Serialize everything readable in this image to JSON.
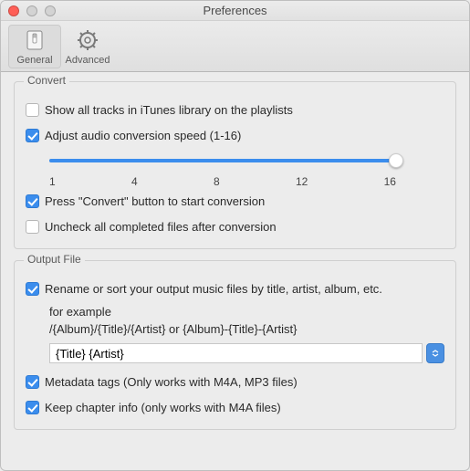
{
  "window": {
    "title": "Preferences"
  },
  "toolbar": {
    "general": "General",
    "advanced": "Advanced"
  },
  "convert": {
    "label": "Convert",
    "show_all_tracks": "Show all tracks in iTunes library on the playlists",
    "adjust_speed": "Adjust audio conversion speed (1-16)",
    "ticks": {
      "t1": "1",
      "t2": "4",
      "t3": "8",
      "t4": "12",
      "t5": "16"
    },
    "press_convert": "Press \"Convert\" button to start conversion",
    "uncheck_completed": "Uncheck all completed files after conversion"
  },
  "output": {
    "label": "Output File",
    "rename": "Rename or sort your output music files by title, artist, album, etc.",
    "example_label": "for example",
    "example_path": "/{Album}/{Title}/{Artist} or {Album}-{Title}-{Artist}",
    "pattern_value": "{Title} {Artist}",
    "metadata": "Metadata tags (Only works with M4A, MP3 files)",
    "chapter": "Keep chapter info (only works with  M4A files)"
  }
}
